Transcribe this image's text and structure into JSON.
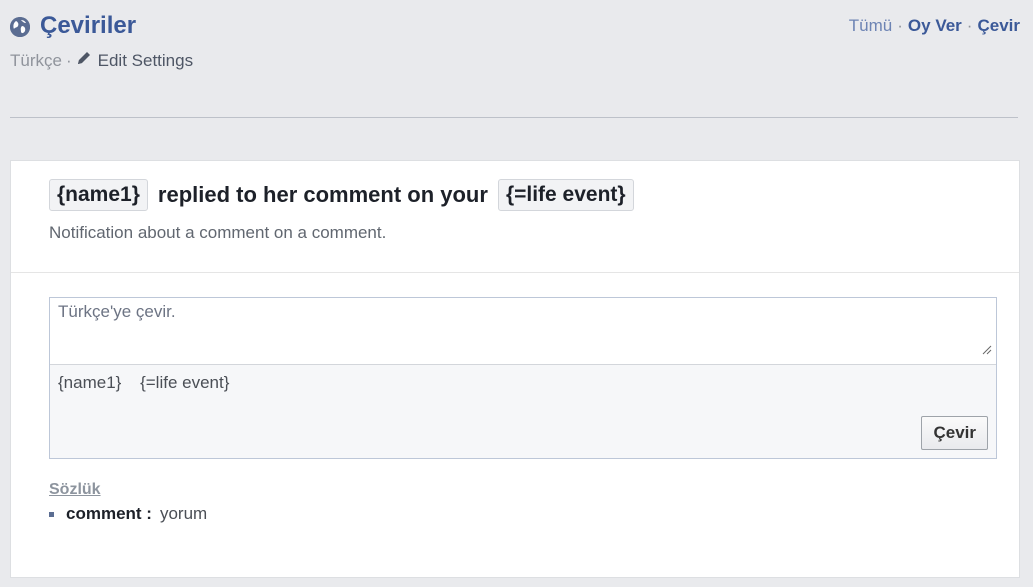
{
  "header": {
    "icon": "globe-icon",
    "title": "Çeviriler",
    "language": "Türkçe",
    "separator": "·",
    "edit_settings": "Edit Settings"
  },
  "topnav": {
    "all": "Tümü",
    "vote": "Oy Ver",
    "translate": "Çevir",
    "separator": "·"
  },
  "phrase": {
    "token1": "{name1}",
    "text": "replied to her comment on your",
    "token2": "{=life event}",
    "description": "Notification about a comment on a comment."
  },
  "editor": {
    "placeholder": "Türkçe'ye çevir.",
    "tokens": [
      "{name1}",
      "{=life event}"
    ],
    "submit_label": "Çevir"
  },
  "glossary": {
    "heading": "Sözlük",
    "items": [
      {
        "term": "comment :",
        "translation": "yorum"
      }
    ]
  },
  "colors": {
    "background": "#e9eaed",
    "link": "#3b5998",
    "card": "#ffffff"
  }
}
